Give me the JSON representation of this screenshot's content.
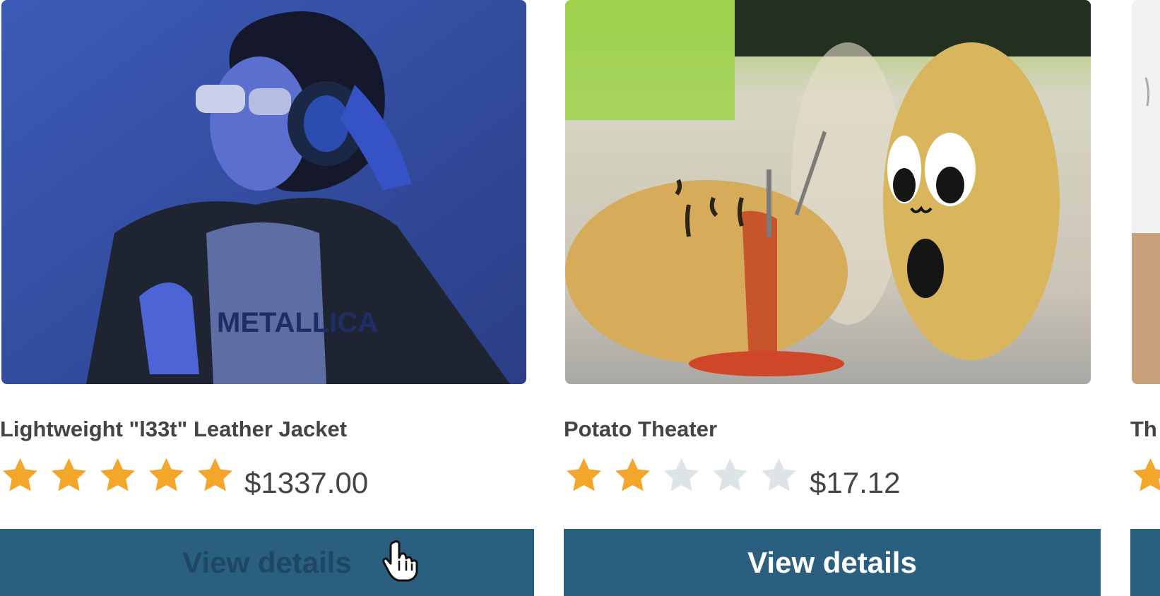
{
  "products": [
    {
      "title": "Lightweight \"l33t\" Leather Jacket",
      "rating": 5,
      "max_rating": 5,
      "price": "$1337.00",
      "button_label": "View details",
      "button_state": "hover"
    },
    {
      "title": "Potato Theater",
      "rating": 2,
      "max_rating": 5,
      "price": "$17.12",
      "button_label": "View details"
    },
    {
      "title": "Th",
      "button_label": ""
    }
  ],
  "colors": {
    "star_filled": "#f4a62a",
    "star_empty": "#dde4e8",
    "button_bg": "#2b5f80",
    "button_text": "#ffffff",
    "button_hover_text": "#1e4763"
  },
  "icons": {
    "star": "star-icon",
    "cursor": "hand-pointer-icon"
  }
}
